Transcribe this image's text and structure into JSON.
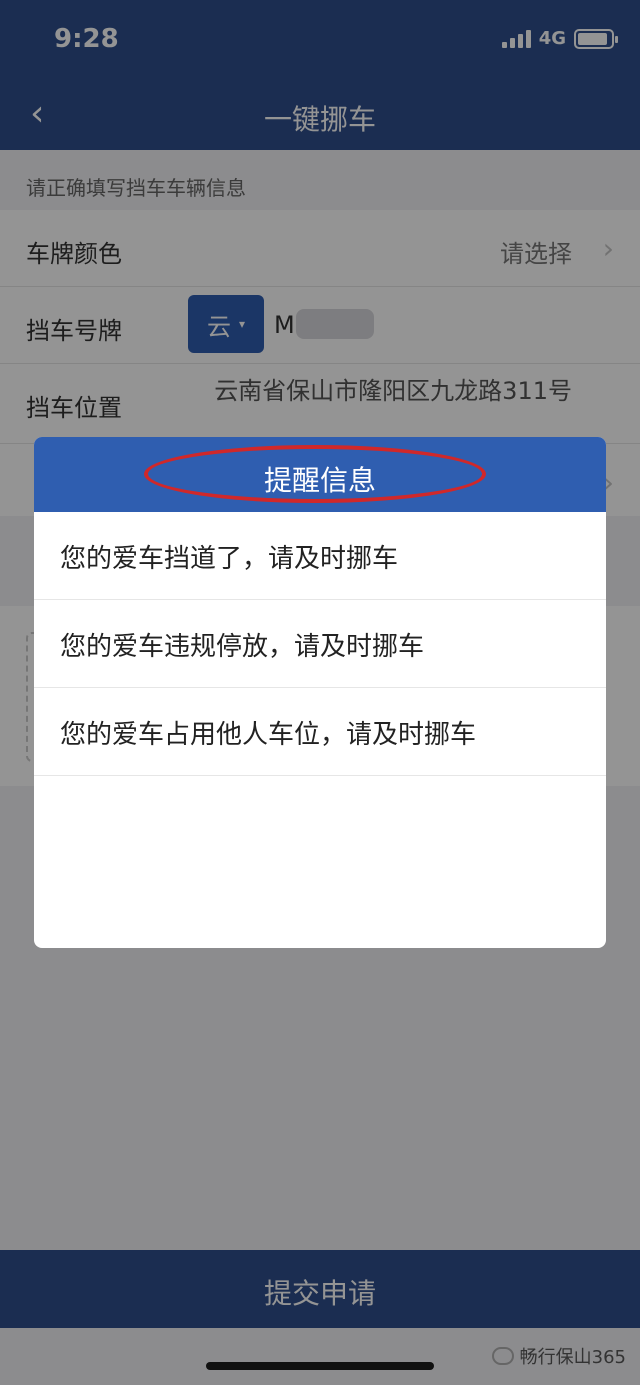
{
  "status": {
    "time": "9:28",
    "network": "4G",
    "battery_level": 0.9
  },
  "nav": {
    "title": "一键挪车",
    "back_icon": "chevron-left-icon"
  },
  "form": {
    "hint": "请正确填写挡车车辆信息",
    "plate_color": {
      "label": "车牌颜色",
      "value": "请选择"
    },
    "plate_number": {
      "label": "挡车号牌",
      "province": "云",
      "prefix": "M"
    },
    "location": {
      "label": "挡车位置",
      "value": "云南省保山市隆阳区九龙路311号"
    }
  },
  "dialog": {
    "title": "提醒信息",
    "options": [
      "您的爱车挡道了，请及时挪车",
      "您的爱车违规停放，请及时挪车",
      "您的爱车占用他人车位，请及时挪车"
    ]
  },
  "submit": {
    "label": "提交申请"
  },
  "watermark": {
    "text": "畅行保山365"
  },
  "colors": {
    "primary": "#2f4f8c",
    "dialog_header": "#2f5eb0",
    "highlight": "#d0282a"
  }
}
